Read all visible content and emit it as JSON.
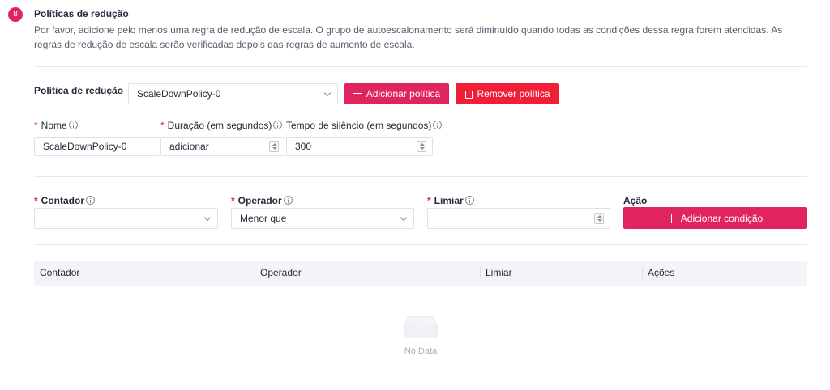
{
  "section": {
    "step": "8",
    "title": "Políticas de redução",
    "description": "Por favor, adicione pelo menos uma regra de redução de escala. O grupo de autoescalonamento será diminuído quando todas as condições dessa regra forem atendidas. As regras de redução de escala serão verificadas depois das regras de aumento de escala."
  },
  "policy": {
    "label": "Política de redução",
    "selected": "ScaleDownPolicy-0",
    "add_button": "Adicionar política",
    "remove_button": "Remover política"
  },
  "fields": {
    "name_label": "Nome",
    "name_value": "ScaleDownPolicy-0",
    "duration_label": "Duração (em segundos)",
    "duration_value": "adicionar",
    "silence_label": "Tempo de silêncio (em segundos)",
    "silence_value": "300",
    "required_mark": "*"
  },
  "condition": {
    "counter_label": "Contador",
    "counter_value": "",
    "operator_label": "Operador",
    "operator_value": "Menor que",
    "threshold_label": "Limiar",
    "threshold_value": "",
    "action_label": "Ação",
    "add_button": "Adicionar condição"
  },
  "table": {
    "columns": [
      "Contador",
      "Operador",
      "Limiar",
      "Ações"
    ],
    "empty_text": "No Data"
  },
  "colors": {
    "brand": "#e0245e",
    "danger": "#f01e36",
    "header_bg": "#f3f4f7"
  }
}
